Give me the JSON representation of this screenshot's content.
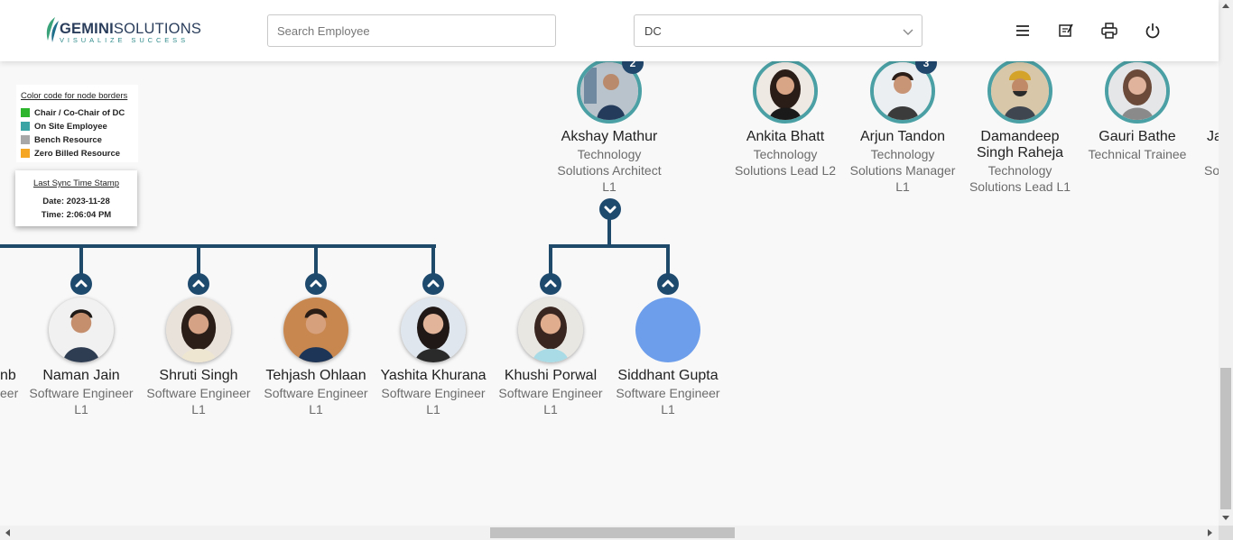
{
  "header": {
    "logo_name": "GEMINI",
    "logo_name_suffix": "SOLUTIONS",
    "logo_tagline": "VISUALIZE SUCCESS",
    "search_placeholder": "Search Employee",
    "dc_value": "DC",
    "buttons": [
      "menu-icon",
      "notes-icon",
      "print-icon",
      "power-icon"
    ]
  },
  "legend": {
    "title": "Color code for node borders",
    "items": [
      {
        "label": "Chair / Co-Chair of DC",
        "color": "#2db52d"
      },
      {
        "label": "On Site Employee",
        "color": "#3aa3a3"
      },
      {
        "label": "Bench Resource",
        "color": "#a8a8a8"
      },
      {
        "label": "Zero Billed Resource",
        "color": "#f5a623"
      }
    ]
  },
  "sync": {
    "title": "Last Sync Time Stamp",
    "date": "Date: 2023-11-28",
    "time": "Time: 2:06:04 PM"
  },
  "top_nodes": [
    {
      "name": "Akshay Mathur",
      "lines": [
        "Technology",
        "Solutions Architect",
        "L1"
      ],
      "badge": "2",
      "border": "onsite"
    },
    {
      "name": "Ankita Bhatt",
      "lines": [
        "Technology",
        "Solutions Lead L2"
      ],
      "border": "onsite"
    },
    {
      "name": "Arjun Tandon",
      "lines": [
        "Technology",
        "Solutions Manager",
        "L1"
      ],
      "badge": "3",
      "border": "onsite"
    },
    {
      "name": "Damandeep Singh Raheja",
      "name_lines": [
        "Damandeep",
        "Singh Raheja"
      ],
      "lines": [
        "Technology",
        "Solutions Lead L1"
      ],
      "border": "onsite"
    },
    {
      "name": "Gauri Bathe",
      "lines": [
        "Technical Trainee"
      ],
      "border": "onsite"
    },
    {
      "name": "Ja",
      "lines": [
        "So"
      ]
    }
  ],
  "bottom_nodes": [
    {
      "name": "nb",
      "lines": [
        "eer"
      ]
    },
    {
      "name": "Naman Jain",
      "lines": [
        "Software Engineer",
        "L1"
      ]
    },
    {
      "name": "Shruti Singh",
      "lines": [
        "Software Engineer",
        "L1"
      ]
    },
    {
      "name": "Tehjash Ohlaan",
      "lines": [
        "Software Engineer",
        "L1"
      ]
    },
    {
      "name": "Yashita Khurana",
      "lines": [
        "Software Engineer",
        "L1"
      ]
    },
    {
      "name": "Khushi Porwal",
      "lines": [
        "Software Engineer",
        "L1"
      ]
    },
    {
      "name": "Siddhant Gupta",
      "lines": [
        "Software Engineer",
        "L1"
      ]
    }
  ],
  "colors": {
    "connector": "#204a6a",
    "onsite_border": "#4aa0a4",
    "blank_avatar": "#6d9eeb"
  }
}
